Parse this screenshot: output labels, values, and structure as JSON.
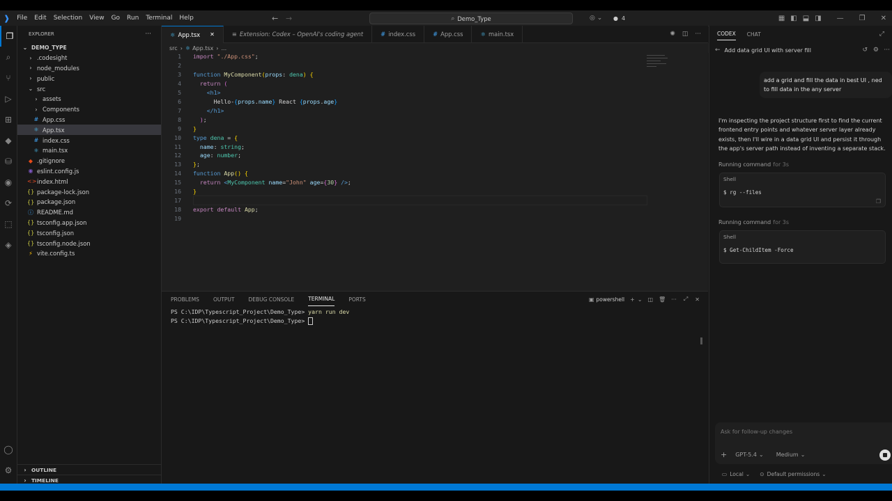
{
  "titlebar": {
    "menu": [
      "File",
      "Edit",
      "Selection",
      "View",
      "Go",
      "Run",
      "Terminal",
      "Help"
    ],
    "search": "Demo_Type",
    "counter": "4"
  },
  "activity_icons": [
    "explorer-icon",
    "search-icon",
    "source-control-icon",
    "run-debug-icon",
    "extensions-icon",
    "python-icon",
    "database-icon",
    "github-icon",
    "remote-icon",
    "container-icon",
    "python-env-icon"
  ],
  "sidebar": {
    "title": "EXPLORER",
    "project": "DEMO_TYPE",
    "items": [
      {
        "label": ".codesight",
        "icon": "›",
        "indent": 1,
        "color": "#cccccc"
      },
      {
        "label": "node_modules",
        "icon": "›",
        "indent": 1,
        "color": "#cccccc"
      },
      {
        "label": "public",
        "icon": "›",
        "indent": 1,
        "color": "#cccccc"
      },
      {
        "label": "src",
        "icon": "⌄",
        "indent": 1,
        "color": "#cccccc"
      },
      {
        "label": "assets",
        "icon": "›",
        "indent": 2,
        "color": "#cccccc"
      },
      {
        "label": "Components",
        "icon": "›",
        "indent": 2,
        "color": "#cccccc"
      },
      {
        "label": "App.css",
        "icon": "#",
        "indent": 2,
        "color": "#42a5f5"
      },
      {
        "label": "App.tsx",
        "icon": "⚛",
        "indent": 2,
        "color": "#4fc3f7"
      },
      {
        "label": "index.css",
        "icon": "#",
        "indent": 2,
        "color": "#42a5f5"
      },
      {
        "label": "main.tsx",
        "icon": "⚛",
        "indent": 2,
        "color": "#4fc3f7"
      },
      {
        "label": ".gitignore",
        "icon": "◆",
        "indent": 1,
        "color": "#e64a19"
      },
      {
        "label": "eslint.config.js",
        "icon": "◉",
        "indent": 1,
        "color": "#7e57c2"
      },
      {
        "label": "index.html",
        "icon": "<>",
        "indent": 1,
        "color": "#e44d26"
      },
      {
        "label": "package-lock.json",
        "icon": "{}",
        "indent": 1,
        "color": "#cbcb41"
      },
      {
        "label": "package.json",
        "icon": "{}",
        "indent": 1,
        "color": "#cbcb41"
      },
      {
        "label": "README.md",
        "icon": "ⓘ",
        "indent": 1,
        "color": "#42a5f5"
      },
      {
        "label": "tsconfig.app.json",
        "icon": "{}",
        "indent": 1,
        "color": "#cbcb41"
      },
      {
        "label": "tsconfig.json",
        "icon": "{}",
        "indent": 1,
        "color": "#cbcb41"
      },
      {
        "label": "tsconfig.node.json",
        "icon": "{}",
        "indent": 1,
        "color": "#cbcb41"
      },
      {
        "label": "vite.config.ts",
        "icon": "⚡",
        "indent": 1,
        "color": "#ffc107"
      }
    ],
    "active_item": "App.tsx",
    "outline": "OUTLINE",
    "timeline": "TIMELINE"
  },
  "tabs": [
    {
      "label": "App.tsx",
      "icon": "⚛",
      "color": "#4fc3f7",
      "active": true
    },
    {
      "label": "Extension: Codex – OpenAI's coding agent",
      "icon": "≡",
      "color": "#9d9d9d",
      "active": false
    },
    {
      "label": "index.css",
      "icon": "#",
      "color": "#42a5f5",
      "active": false
    },
    {
      "label": "App.css",
      "icon": "#",
      "color": "#42a5f5",
      "active": false
    },
    {
      "label": "main.tsx",
      "icon": "⚛",
      "color": "#4fc3f7",
      "active": false
    }
  ],
  "breadcrumb": [
    "src",
    "App.tsx",
    "..."
  ],
  "code": [
    {
      "n": "1",
      "t": [
        [
          "kw2",
          "import "
        ],
        [
          "str",
          "\"./App.css\""
        ],
        [
          "pl",
          ";"
        ]
      ]
    },
    {
      "n": "2",
      "t": []
    },
    {
      "n": "3",
      "t": [
        [
          "kw",
          "function "
        ],
        [
          "fn",
          "MyComponent"
        ],
        [
          "br1",
          "("
        ],
        [
          "var",
          "props"
        ],
        [
          "pl",
          ": "
        ],
        [
          "ty",
          "dena"
        ],
        [
          "br1",
          ")"
        ],
        [
          "pl",
          " "
        ],
        [
          "br1",
          "{"
        ]
      ]
    },
    {
      "n": "4",
      "t": [
        [
          "pl",
          "  "
        ],
        [
          "kw2",
          "return "
        ],
        [
          "br2",
          "("
        ]
      ]
    },
    {
      "n": "5",
      "t": [
        [
          "pl",
          "    "
        ],
        [
          "tag",
          "<h1>"
        ]
      ]
    },
    {
      "n": "6",
      "t": [
        [
          "pl",
          "      Hello-"
        ],
        [
          "br3",
          "{"
        ],
        [
          "var",
          "props"
        ],
        [
          "pl",
          "."
        ],
        [
          "var",
          "name"
        ],
        [
          "br3",
          "}"
        ],
        [
          "pl",
          " React "
        ],
        [
          "br3",
          "{"
        ],
        [
          "var",
          "props"
        ],
        [
          "pl",
          "."
        ],
        [
          "var",
          "age"
        ],
        [
          "br3",
          "}"
        ]
      ]
    },
    {
      "n": "7",
      "t": [
        [
          "pl",
          "    "
        ],
        [
          "tag",
          "</h1>"
        ]
      ]
    },
    {
      "n": "8",
      "t": [
        [
          "pl",
          "  "
        ],
        [
          "br2",
          ")"
        ],
        [
          "pl",
          ";"
        ]
      ]
    },
    {
      "n": "9",
      "t": [
        [
          "br1",
          "}"
        ]
      ]
    },
    {
      "n": "10",
      "t": [
        [
          "kw",
          "type "
        ],
        [
          "ty",
          "dena"
        ],
        [
          "pl",
          " = "
        ],
        [
          "br1",
          "{"
        ]
      ]
    },
    {
      "n": "11",
      "t": [
        [
          "pl",
          "  "
        ],
        [
          "var",
          "name"
        ],
        [
          "pl",
          ": "
        ],
        [
          "ty",
          "string"
        ],
        [
          "pl",
          ";"
        ]
      ]
    },
    {
      "n": "12",
      "t": [
        [
          "pl",
          "  "
        ],
        [
          "var",
          "age"
        ],
        [
          "pl",
          ": "
        ],
        [
          "ty",
          "number"
        ],
        [
          "pl",
          ";"
        ]
      ]
    },
    {
      "n": "13",
      "t": [
        [
          "br1",
          "}"
        ],
        [
          "pl",
          ";"
        ]
      ]
    },
    {
      "n": "14",
      "t": [
        [
          "kw",
          "function "
        ],
        [
          "fn",
          "App"
        ],
        [
          "br1",
          "()"
        ],
        [
          "pl",
          " "
        ],
        [
          "br1",
          "{"
        ]
      ]
    },
    {
      "n": "15",
      "t": [
        [
          "pl",
          "  "
        ],
        [
          "kw2",
          "return "
        ],
        [
          "tag",
          "<"
        ],
        [
          "ty",
          "MyComponent"
        ],
        [
          "pl",
          " "
        ],
        [
          "var",
          "name"
        ],
        [
          "pl",
          "="
        ],
        [
          "str",
          "\"John\""
        ],
        [
          "pl",
          " "
        ],
        [
          "var",
          "age"
        ],
        [
          "pl",
          "="
        ],
        [
          "br2",
          "{"
        ],
        [
          "num",
          "30"
        ],
        [
          "br2",
          "}"
        ],
        [
          "pl",
          " "
        ],
        [
          "tag",
          "/>"
        ],
        [
          "pl",
          ";"
        ]
      ]
    },
    {
      "n": "16",
      "t": [
        [
          "br1",
          "}"
        ]
      ]
    },
    {
      "n": "17",
      "t": []
    },
    {
      "n": "18",
      "t": [
        [
          "kw2",
          "export default "
        ],
        [
          "fn",
          "App"
        ],
        [
          "pl",
          ";"
        ]
      ]
    },
    {
      "n": "19",
      "t": []
    }
  ],
  "panel": {
    "tabs": [
      "PROBLEMS",
      "OUTPUT",
      "DEBUG CONSOLE",
      "TERMINAL",
      "PORTS"
    ],
    "active_tab": "TERMINAL",
    "shell": "powershell",
    "lines": [
      {
        "prompt": "PS C:\\IDP\\Typescript_Project\\Demo_Type> ",
        "cmd": "yarn run dev"
      },
      {
        "prompt": "PS C:\\IDP\\Typescript_Project\\Demo_Type> ",
        "cmd": ""
      }
    ]
  },
  "codex": {
    "tabs": [
      "CODEX",
      "CHAT"
    ],
    "active_tab": "CODEX",
    "thread_title": "Add data grid UI with server fill",
    "user_message": "add a grid and fill the data in best UI , ned to fill data in the any server",
    "assistant_message": "I'm inspecting the project structure first to find the current frontend entry points and whatever server layer already exists, then I'll wire in a data grid UI and persist it through the app's server path instead of inventing a separate stack.",
    "runs": [
      {
        "status": "Running command",
        "duration": "for 3s",
        "shell": "Shell",
        "command": "$ rg --files"
      },
      {
        "status": "Running command",
        "duration": "for 3s",
        "shell": "Shell",
        "command": "$ Get-ChildItem -Force"
      }
    ],
    "input_placeholder": "Ask for follow-up changes",
    "model": "GPT-5.4",
    "effort": "Medium",
    "env": "Local",
    "permissions": "Default permissions"
  }
}
